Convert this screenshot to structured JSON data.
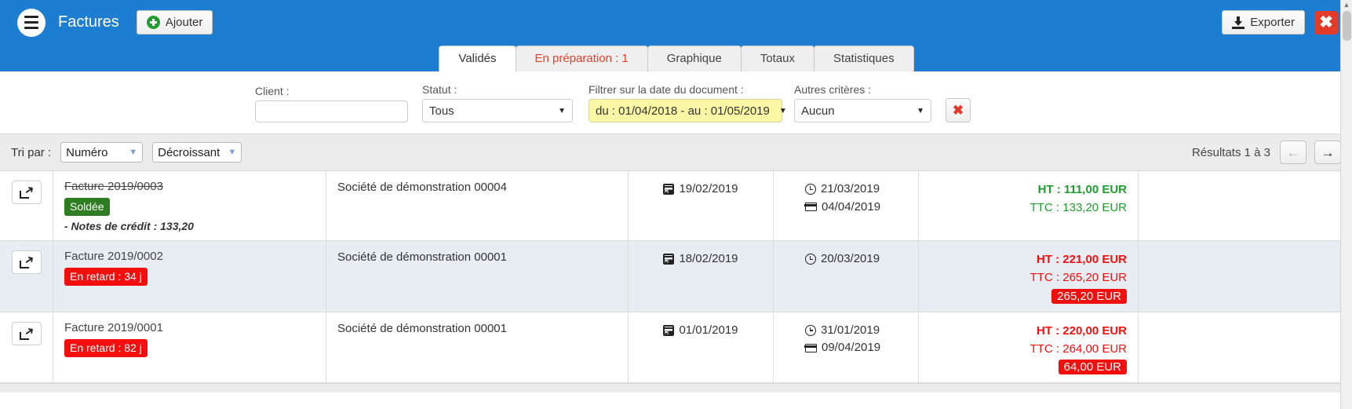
{
  "header": {
    "menu_icon": "hamburger-icon",
    "title": "Factures",
    "add_label": "Ajouter",
    "export_label": "Exporter",
    "close_label": "✖"
  },
  "tabs": [
    {
      "label": "Validés",
      "state": "active"
    },
    {
      "label": "En préparation : 1",
      "state": "warn"
    },
    {
      "label": "Graphique",
      "state": "normal"
    },
    {
      "label": "Totaux",
      "state": "normal"
    },
    {
      "label": "Statistiques",
      "state": "normal"
    }
  ],
  "filters": {
    "client": {
      "label": "Client :",
      "value": "",
      "placeholder": ""
    },
    "statut": {
      "label": "Statut :",
      "value": "Tous"
    },
    "date": {
      "label": "Filtrer sur la date du document :",
      "value": "du : 01/04/2018 - au : 01/05/2019"
    },
    "autres": {
      "label": "Autres critères :",
      "value": "Aucun"
    },
    "clear_label": "✖"
  },
  "sortbar": {
    "tri_label": "Tri par :",
    "sort_field": "Numéro",
    "sort_order": "Décroissant",
    "results_text": "Résultats 1 à 3",
    "prev_label": "←",
    "next_label": "→"
  },
  "rows": [
    {
      "action_icon": "share-arrow-icon",
      "reference": "Facture 2019/0003",
      "struck": true,
      "badge": {
        "text": "Soldée",
        "color": "green"
      },
      "credit_note": "- Notes de crédit : 133,20",
      "client": "Société de démonstration 00004",
      "doc_date": "19/02/2019",
      "due_date": "21/03/2019",
      "pay_date": "04/04/2019",
      "amount_ht": "HT : 111,00 EUR",
      "amount_ttc": "TTC : 133,20 EUR",
      "amount_color": "green",
      "due_badge": ""
    },
    {
      "action_icon": "share-arrow-icon",
      "reference": "Facture 2019/0002",
      "struck": false,
      "badge": {
        "text": "En retard : 34 j",
        "color": "red"
      },
      "credit_note": "",
      "client": "Société de démonstration 00001",
      "doc_date": "18/02/2019",
      "due_date": "20/03/2019",
      "pay_date": "",
      "amount_ht": "HT : 221,00 EUR",
      "amount_ttc": "TTC : 265,20 EUR",
      "amount_color": "red",
      "due_badge": "265,20 EUR"
    },
    {
      "action_icon": "share-arrow-icon",
      "reference": "Facture 2019/0001",
      "struck": false,
      "badge": {
        "text": "En retard : 82 j",
        "color": "red"
      },
      "credit_note": "",
      "client": "Société de démonstration 00001",
      "doc_date": "01/01/2019",
      "due_date": "31/01/2019",
      "pay_date": "09/04/2019",
      "amount_ht": "HT : 220,00 EUR",
      "amount_ttc": "TTC : 264,00 EUR",
      "amount_color": "red",
      "due_badge": "64,00 EUR"
    }
  ],
  "colors": {
    "brand_blue": "#1d7dd1",
    "green": "#1f9d2f",
    "red": "#f40f0f",
    "badge_green": "#2e7d23",
    "yellow_filter": "#fbf8a5",
    "row_even": "#e7edf3"
  }
}
